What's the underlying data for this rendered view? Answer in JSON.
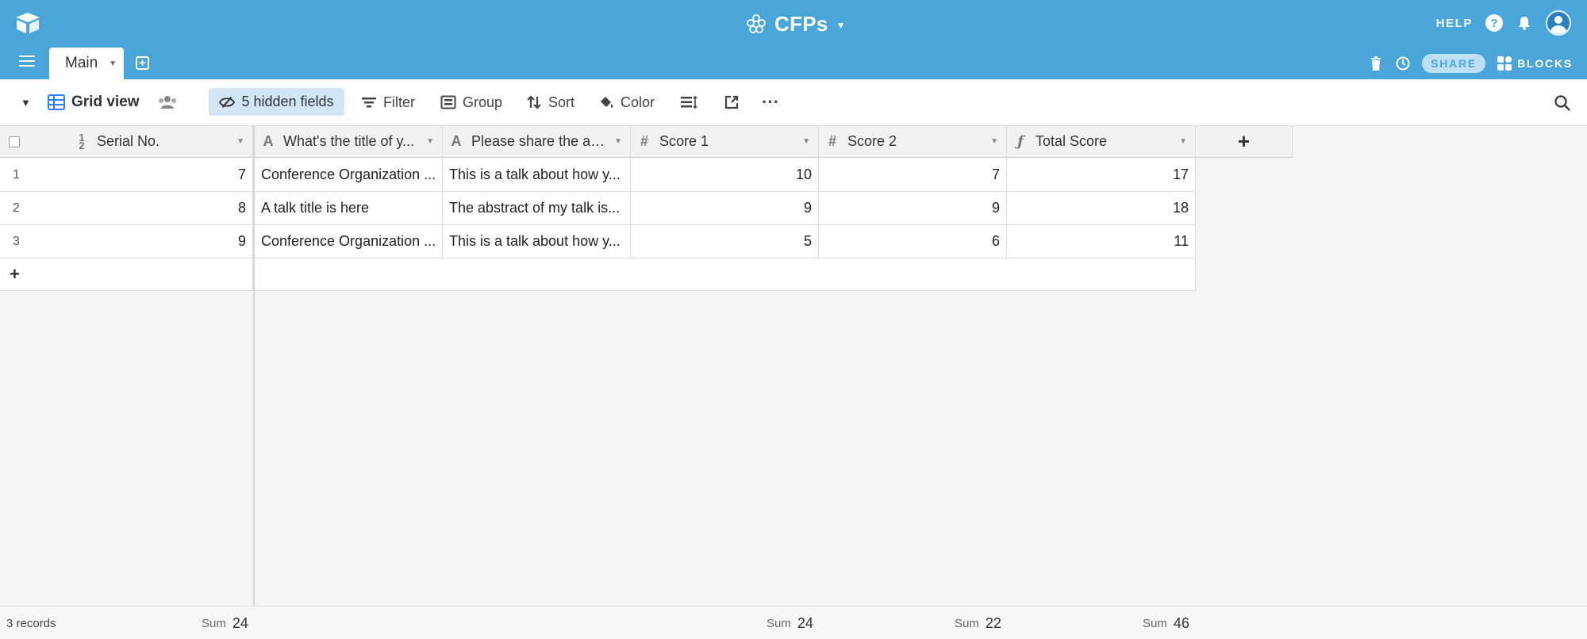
{
  "app": {
    "base_title": "CFPs",
    "help_label": "HELP"
  },
  "tabs": {
    "active": "Main"
  },
  "toolbar_right": {
    "share_label": "SHARE",
    "blocks_label": "BLOCKS"
  },
  "viewbar": {
    "view_name": "Grid view",
    "hidden_fields": "5 hidden fields",
    "filter": "Filter",
    "group": "Group",
    "sort": "Sort",
    "color": "Color"
  },
  "columns": [
    {
      "label": "Serial No.",
      "icon": "autonumber-icon"
    },
    {
      "label": "What's the title of y...",
      "icon": "text-icon"
    },
    {
      "label": "Please share the ab...",
      "icon": "text-icon"
    },
    {
      "label": "Score 1",
      "icon": "number-icon"
    },
    {
      "label": "Score 2",
      "icon": "number-icon"
    },
    {
      "label": "Total Score",
      "icon": "formula-icon"
    }
  ],
  "rows": [
    {
      "n": "1",
      "serial": "7",
      "title": "Conference Organization ...",
      "abstract": "This is a talk about how y...",
      "s1": "10",
      "s2": "7",
      "total": "17"
    },
    {
      "n": "2",
      "serial": "8",
      "title": "A talk title is here",
      "abstract": "The abstract of my talk is...",
      "s1": "9",
      "s2": "9",
      "total": "18"
    },
    {
      "n": "3",
      "serial": "9",
      "title": "Conference Organization ...",
      "abstract": "This is a talk about how y...",
      "s1": "5",
      "s2": "6",
      "total": "11"
    }
  ],
  "footer": {
    "records": "3 records",
    "sum_label": "Sum",
    "serial_sum": "24",
    "score1_sum": "24",
    "score2_sum": "22",
    "total_sum": "46"
  },
  "colors": {
    "header_blue": "#4aa6d8",
    "hidden_fields_bg": "#d1e6f5"
  }
}
